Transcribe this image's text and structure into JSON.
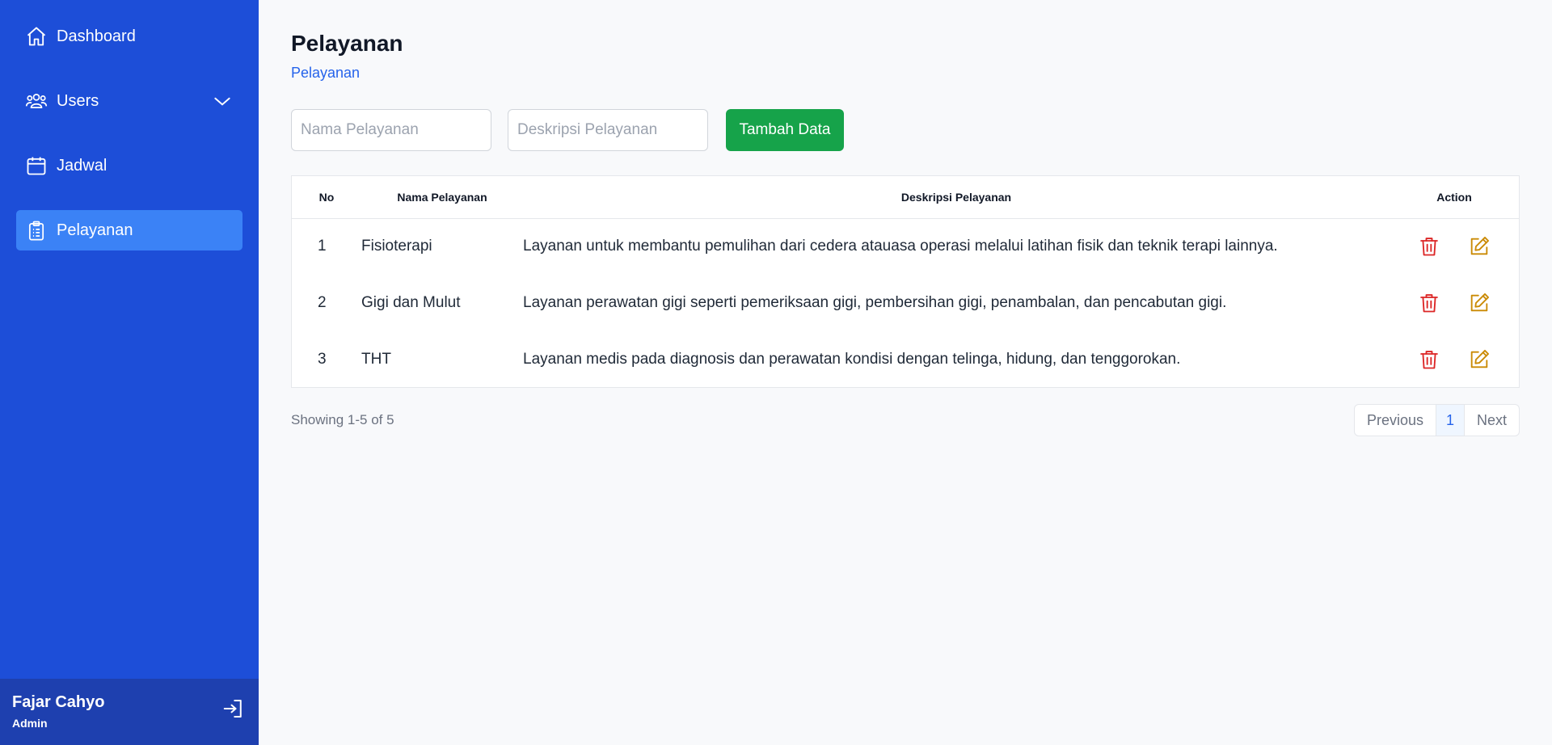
{
  "sidebar": {
    "items": [
      {
        "label": "Dashboard",
        "icon": "home-icon"
      },
      {
        "label": "Users",
        "icon": "users-icon"
      },
      {
        "label": "Jadwal",
        "icon": "calendar-icon"
      },
      {
        "label": "Pelayanan",
        "icon": "clipboard-icon",
        "active": true
      }
    ],
    "user": {
      "name": "Fajar Cahyo",
      "role": "Admin"
    }
  },
  "page": {
    "title": "Pelayanan",
    "breadcrumb": "Pelayanan"
  },
  "form": {
    "nama_placeholder": "Nama Pelayanan",
    "deskripsi_placeholder": "Deskripsi Pelayanan",
    "add_label": "Tambah Data"
  },
  "table": {
    "headers": [
      "No",
      "Nama Pelayanan",
      "Deskripsi Pelayanan",
      "Action"
    ],
    "rows": [
      {
        "no": "1",
        "nama": "Fisioterapi",
        "deskripsi": "Layanan untuk membantu pemulihan dari cedera atauasa operasi melalui latihan fisik dan teknik terapi lainnya."
      },
      {
        "no": "2",
        "nama": "Gigi dan Mulut",
        "deskripsi": "Layanan perawatan gigi seperti pemeriksaan gigi, pembersihan gigi, penambalan, dan pencabutan gigi."
      },
      {
        "no": "3",
        "nama": "THT",
        "deskripsi": "Layanan medis pada diagnosis dan perawatan kondisi dengan telinga, hidung, dan tenggorokan."
      }
    ]
  },
  "pagination": {
    "showing": "Showing 1-5 of 5",
    "previous": "Previous",
    "current": "1",
    "next": "Next"
  },
  "colors": {
    "sidebar": "#1d4ed8",
    "active_item": "#3b82f6",
    "add_button": "#16a34a",
    "delete_icon": "#dc2626",
    "edit_icon": "#ca8a04"
  }
}
